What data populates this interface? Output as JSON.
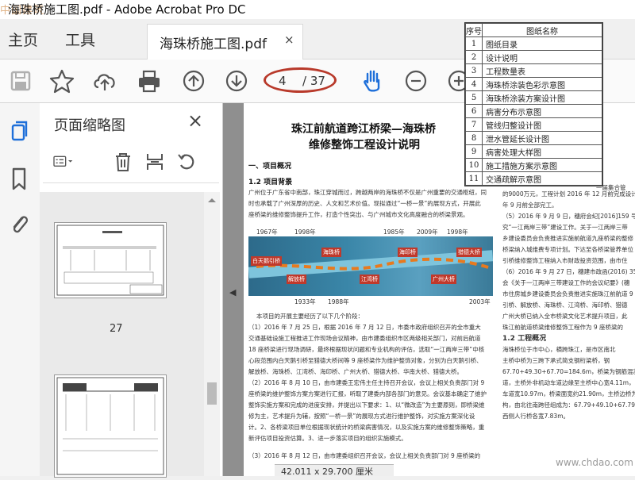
{
  "window": {
    "title": "海珠桥施工图.pdf - Adobe Acrobat Pro DC",
    "watermark": "中国建筑"
  },
  "menu": {
    "home": "主页",
    "tools": "工具"
  },
  "tab": {
    "label": "海珠桥施工图.pdf",
    "close": "×"
  },
  "toolbar": {
    "page_current": "4",
    "page_total": "/ 37"
  },
  "panel": {
    "title": "页面缩略图",
    "close": "×",
    "thumb_label": "27"
  },
  "document": {
    "title_line1": "珠江前航道跨江桥梁—海珠桥",
    "title_line2": "维修整饰工程设计说明",
    "section1": "一、项目概况",
    "section1_1": "1.2 项目背景",
    "para1": "广州位于广东省中南部，珠江穿城而过，跨越两岸的海珠桥不仅是广州重要的交通枢纽，同时也承载了广州深厚的历史、人文和艺术价值。现拟通过“一桥一景”的展现方式，开展此座桥梁的维修整饰提升工作，打造个性突出、与广州城市文化高度融合的桥梁景观。",
    "years": [
      "1967年",
      "1998年",
      "1985年",
      "2009年",
      "1998年",
      "1933年",
      "1988年",
      "2003年"
    ],
    "para2": "本项目的开展主要经历了以下几个阶段：",
    "para3": "（1）2016 年 7 月 25 日，根据 2016 年 7 月 12 日，市委市政府组织召开的全市重大交通基础设施工程推进工作现场会议精神，由市建委组织市区两级相关部门，对前后航道 18 座桥梁进行现场调研，最终根据现状问题和专业机构的评估，选取“一江两岸三带”中核心段范围内白天鹅引桥至猎德大桥间等 9 座桥梁作为维护整饰对象，分别为白天鹅引桥、解放桥、海珠桥、江湾桥、海印桥、广州大桥、猎德大桥、华南大桥、猎德大桥。",
    "para4": "（2）2016 年 8 月 10 日，由市建委王宏伟主任主持召开会议，会议上相关负责部门对 9 座桥梁的维护整饰方案方案进行汇报，听取了建委内部各部门的意见。会议基本确定了维护整饰实施方案和完成的进度安排，并提出以下要求：1、以“微改造”为主要原则，即桥梁维修为主，艺术提升为辅，按照“一桥一景”的展现方式进行维护整饰，对实施方案深化设计。2、各桥梁项目单位根据现状统计的桥梁病害情况，以及实施方案的维修整饰策略，重新评估项目投资估算。3、进一步落实项目的组织实施模式。",
    "para5": "（3）2016 年 8 月 12 日，由市建委组织召开会议，会议上相关负责部门对 9 座桥梁的",
    "size_bar": "42.011 x 29.700 厘米",
    "photo_labels": [
      "白天鹅引桥",
      "解放桥",
      "海珠桥",
      "江湾桥",
      "海印桥",
      "广州大桥",
      "猎德大桥"
    ]
  },
  "drawing_list": {
    "headers": [
      "序号",
      "图纸名称"
    ],
    "rows": [
      [
        "1",
        "图纸目录"
      ],
      [
        "2",
        "设计说明"
      ],
      [
        "3",
        "工程数量表"
      ],
      [
        "4",
        "海珠桥涂装色彩示意图"
      ],
      [
        "5",
        "海珠桥涂装方案设计图"
      ],
      [
        "6",
        "病害分布示意图"
      ],
      [
        "7",
        "管线归整设计图"
      ],
      [
        "8",
        "泄水管延长设计图"
      ],
      [
        "9",
        "病害处理大样图"
      ],
      [
        "10",
        "施工措施方案示意图"
      ],
      [
        "11",
        "交通疏解示意图"
      ]
    ]
  },
  "right_column": {
    "lines": [
      "钢整桥梁管",
      "资桥梁维",
      "经济技术指",
      "处，保留原",
      "，体现现代",
      "一届集合管",
      "的9000万元，工程计划 2016 年 12 月前完成设计",
      "年 9 月前全部完工。",
      "（5）2016 年 9 月 9 日，穗府会纪[2016]159 号",
      "究“一江两岸三带”建设工作。关于一江两岸三带",
      "乡建设委员会负责推进实施前航道九座桥梁的整修",
      "桥梁纳入城维费专项计划。下达至各桥梁管养单位",
      "引桥维修整饰工程纳入市财政投资范围，由市住",
      "（6）2016 年 9 月 27 日，穗建市政函(2016) 35",
      "会《关于一江两岸三带建设工作的会议纪要》(穗",
      "市住房城乡建设委员会负责推进实施珠江前航道 9",
      "引桥、解放桥、海珠桥、江湾桥、海印桥、猎德",
      "广州大桥已纳入全市桥梁文化艺术提升项目，此",
      "珠江前航道桥梁维修整饰工程作为 9 座桥梁的",
      "1.2 工程概况",
      "海珠桥位于市中心，横跨珠江，是市区南北",
      "主桥中桥为三跨下承式简支钢桁梁桥，钢",
      "67.70+49.30+67.70=184.6m，桥梁为钢筋混凝",
      "道，主桥外非机动车道边缘至主桥中心宽4.11m，",
      "车道宽10.97m，桥梁面宽约21.90m，主桥边桥为",
      "构，由北往南跨径组成为：67.79+49.10+67.79=18",
      "西侧人行桥各宽7.83m。"
    ],
    "watermark": "www.chdao.com"
  }
}
